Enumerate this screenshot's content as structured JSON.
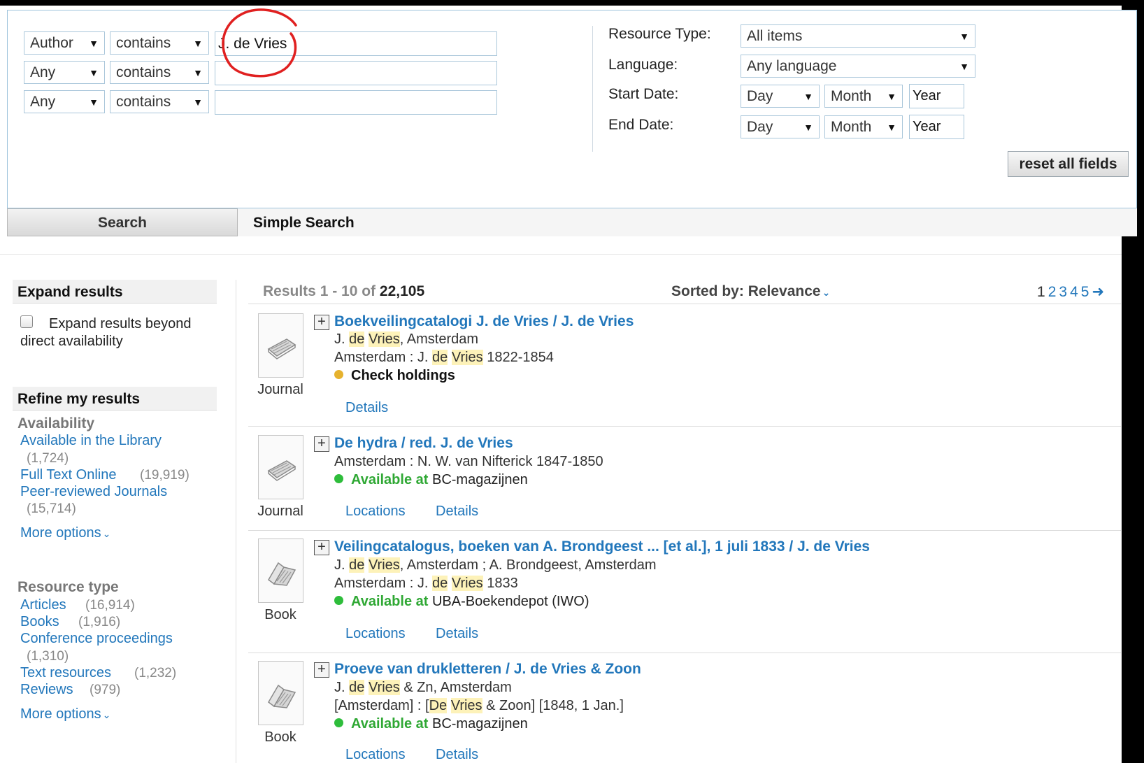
{
  "search": {
    "rows": [
      {
        "field": "Author",
        "operator": "contains",
        "value": "J. de Vries"
      },
      {
        "field": "Any",
        "operator": "contains",
        "value": ""
      },
      {
        "field": "Any",
        "operator": "contains",
        "value": ""
      }
    ],
    "resource_type_label": "Resource Type:",
    "resource_type_value": "All items",
    "language_label": "Language:",
    "language_value": "Any language",
    "start_date_label": "Start Date:",
    "end_date_label": "End Date:",
    "day": "Day",
    "month": "Month",
    "year_placeholder": "Year",
    "reset_label": "reset all fields"
  },
  "tabs": {
    "search": "Search",
    "simple": "Simple Search"
  },
  "sidebar": {
    "expand_heading": "Expand results",
    "expand_option_line1": "Expand results beyond",
    "expand_option_line2": "direct availability",
    "refine_heading": "Refine my results",
    "availability_heading": "Availability",
    "availability": [
      {
        "label": "Available in the Library",
        "count": "(1,724)"
      },
      {
        "label": "Full Text Online",
        "count": "(19,919)"
      },
      {
        "label": "Peer-reviewed Journals",
        "count": "(15,714)"
      }
    ],
    "more_options": "More options",
    "resource_heading": "Resource type",
    "resource_types": [
      {
        "label": "Articles",
        "count": "(16,914)"
      },
      {
        "label": "Books",
        "count": "(1,916)"
      },
      {
        "label": "Conference proceedings",
        "count": "(1,310)"
      },
      {
        "label": "Text resources",
        "count": "(1,232)"
      },
      {
        "label": "Reviews",
        "count": "(979)"
      }
    ]
  },
  "results_header": {
    "range": "Results 1 - 10 of",
    "total": "22,105",
    "sorted_label": "Sorted by:",
    "sorted_value": "Relevance",
    "pages": [
      "1",
      "2",
      "3",
      "4",
      "5"
    ]
  },
  "results": [
    {
      "type": "Journal",
      "title": "Boekveilingcatalogi J. de Vries / J. de Vries",
      "line1_pre": "J. ",
      "line1_hl1": "de",
      "line1_mid": " ",
      "line1_hl2": "Vries",
      "line1_post": ", Amsterdam",
      "line2_pre": "Amsterdam : J. ",
      "line2_hl1": "de",
      "line2_mid": " ",
      "line2_hl2": "Vries",
      "line2_post": " 1822-1854",
      "status_prefix": "",
      "status_bold": "Check holdings",
      "status_text": "",
      "links": [
        "Details"
      ]
    },
    {
      "type": "Journal",
      "title": "De hydra / red. J. de Vries",
      "line1": "Amsterdam : N. W. van Nifterick 1847-1850",
      "status_bold": "Available at",
      "status_text": "BC-magazijnen",
      "links": [
        "Locations",
        "Details"
      ]
    },
    {
      "type": "Book",
      "title": "Veilingcatalogus, boeken van A. Brondgeest ... [et al.], 1 juli 1833 / J. de Vries",
      "line1_pre": "J. ",
      "line1_hl1": "de",
      "line1_mid": " ",
      "line1_hl2": "Vries",
      "line1_post": ", Amsterdam ; A. Brondgeest, Amsterdam",
      "line2_pre": "Amsterdam : J. ",
      "line2_hl1": "de",
      "line2_mid": " ",
      "line2_hl2": "Vries",
      "line2_post": " 1833",
      "status_bold": "Available at",
      "status_text": "UBA-Boekendepot (IWO)",
      "links": [
        "Locations",
        "Details"
      ]
    },
    {
      "type": "Book",
      "title": "Proeve van drukletteren / J. de Vries & Zoon",
      "line1_pre": "J. ",
      "line1_hl1": "de",
      "line1_mid": " ",
      "line1_hl2": "Vries",
      "line1_post": " & Zn, Amsterdam",
      "line2_pre": "[Amsterdam] : [",
      "line2_hl1": "De",
      "line2_mid": " ",
      "line2_hl2": "Vries",
      "line2_post": " & Zoon] [1848, 1 Jan.]",
      "status_bold": "Available at",
      "status_text": "BC-magazijnen",
      "links": [
        "Locations",
        "Details"
      ]
    }
  ],
  "colors": {
    "link": "#2277bb",
    "available": "#2ebd3b",
    "check_holdings": "#e6b22e",
    "highlight": "#fdf2b9",
    "annotation": "#e02020"
  }
}
